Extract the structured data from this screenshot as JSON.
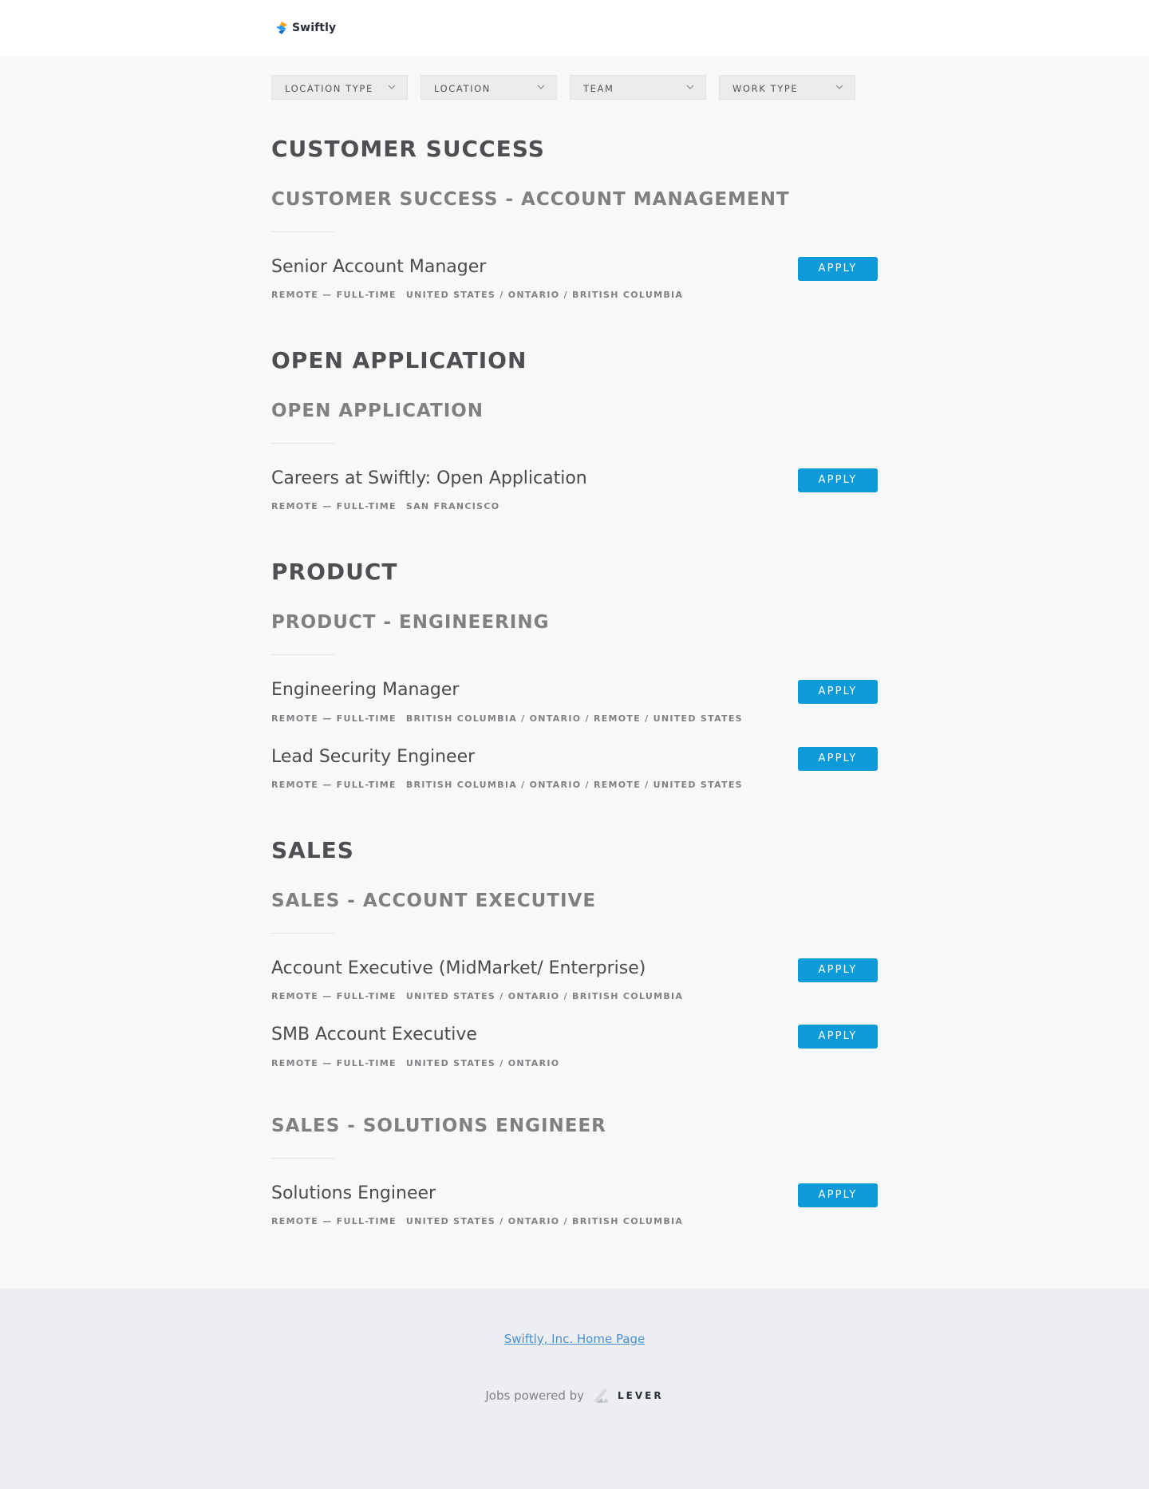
{
  "header": {
    "logo_text": "Swiftly"
  },
  "filters": [
    {
      "label": "LOCATION TYPE"
    },
    {
      "label": "LOCATION"
    },
    {
      "label": "TEAM"
    },
    {
      "label": "WORK TYPE"
    }
  ],
  "departments": [
    {
      "name": "CUSTOMER SUCCESS",
      "teams": [
        {
          "name": "CUSTOMER SUCCESS - ACCOUNT MANAGEMENT",
          "postings": [
            {
              "title": "Senior Account Manager",
              "commitment": "REMOTE — FULL-TIME",
              "location": "UNITED STATES / ONTARIO / BRITISH COLUMBIA",
              "apply": "APPLY"
            }
          ]
        }
      ]
    },
    {
      "name": "OPEN APPLICATION",
      "teams": [
        {
          "name": "OPEN APPLICATION",
          "postings": [
            {
              "title": "Careers at Swiftly: Open Application",
              "commitment": "REMOTE — FULL-TIME",
              "location": "SAN FRANCISCO",
              "apply": "APPLY"
            }
          ]
        }
      ]
    },
    {
      "name": "PRODUCT",
      "teams": [
        {
          "name": "PRODUCT - ENGINEERING",
          "postings": [
            {
              "title": "Engineering Manager",
              "commitment": "REMOTE — FULL-TIME",
              "location": "BRITISH COLUMBIA / ONTARIO / REMOTE / UNITED STATES",
              "apply": "APPLY"
            },
            {
              "title": "Lead Security Engineer",
              "commitment": "REMOTE — FULL-TIME",
              "location": "BRITISH COLUMBIA / ONTARIO / REMOTE / UNITED STATES",
              "apply": "APPLY"
            }
          ]
        }
      ]
    },
    {
      "name": "SALES",
      "teams": [
        {
          "name": "SALES - ACCOUNT EXECUTIVE",
          "postings": [
            {
              "title": "Account Executive (MidMarket/ Enterprise)",
              "commitment": "REMOTE — FULL-TIME",
              "location": "UNITED STATES / ONTARIO / BRITISH COLUMBIA",
              "apply": "APPLY"
            },
            {
              "title": "SMB Account Executive",
              "commitment": "REMOTE — FULL-TIME",
              "location": "UNITED STATES / ONTARIO",
              "apply": "APPLY"
            }
          ]
        },
        {
          "name": "SALES - SOLUTIONS ENGINEER",
          "postings": [
            {
              "title": "Solutions Engineer",
              "commitment": "REMOTE — FULL-TIME",
              "location": "UNITED STATES / ONTARIO / BRITISH COLUMBIA",
              "apply": "APPLY"
            }
          ]
        }
      ]
    }
  ],
  "footer": {
    "home_link": "Swiftly, Inc. Home Page",
    "powered_by": "Jobs powered by",
    "lever_text": "LEVER"
  },
  "colors": {
    "apply_button": "#0c9ad8",
    "page_background": "#f8f8f8",
    "footer_background": "#eceef1",
    "link": "#4a90cf"
  }
}
